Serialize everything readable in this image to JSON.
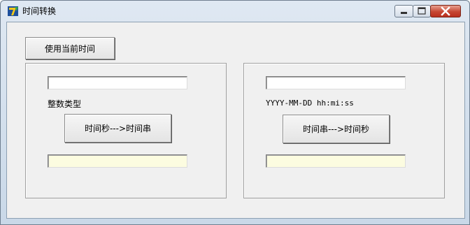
{
  "window": {
    "title": "时间转换",
    "icon": "app-icon",
    "controls": {
      "minimize": "minimize-icon",
      "maximize": "maximize-icon",
      "close": "close-icon"
    }
  },
  "toolbar": {
    "use_current_time_label": "使用当前时间"
  },
  "left_panel": {
    "input_value": "",
    "format_label": "整数类型",
    "convert_button_label": "时间秒--->时间串",
    "result_value": ""
  },
  "right_panel": {
    "input_value": "",
    "format_label": "YYYY-MM-DD hh:mi:ss",
    "convert_button_label": "时间串--->时间秒",
    "result_value": ""
  },
  "colors": {
    "result_field_background": "#fcfce0",
    "client_background": "#f0f0f0"
  }
}
